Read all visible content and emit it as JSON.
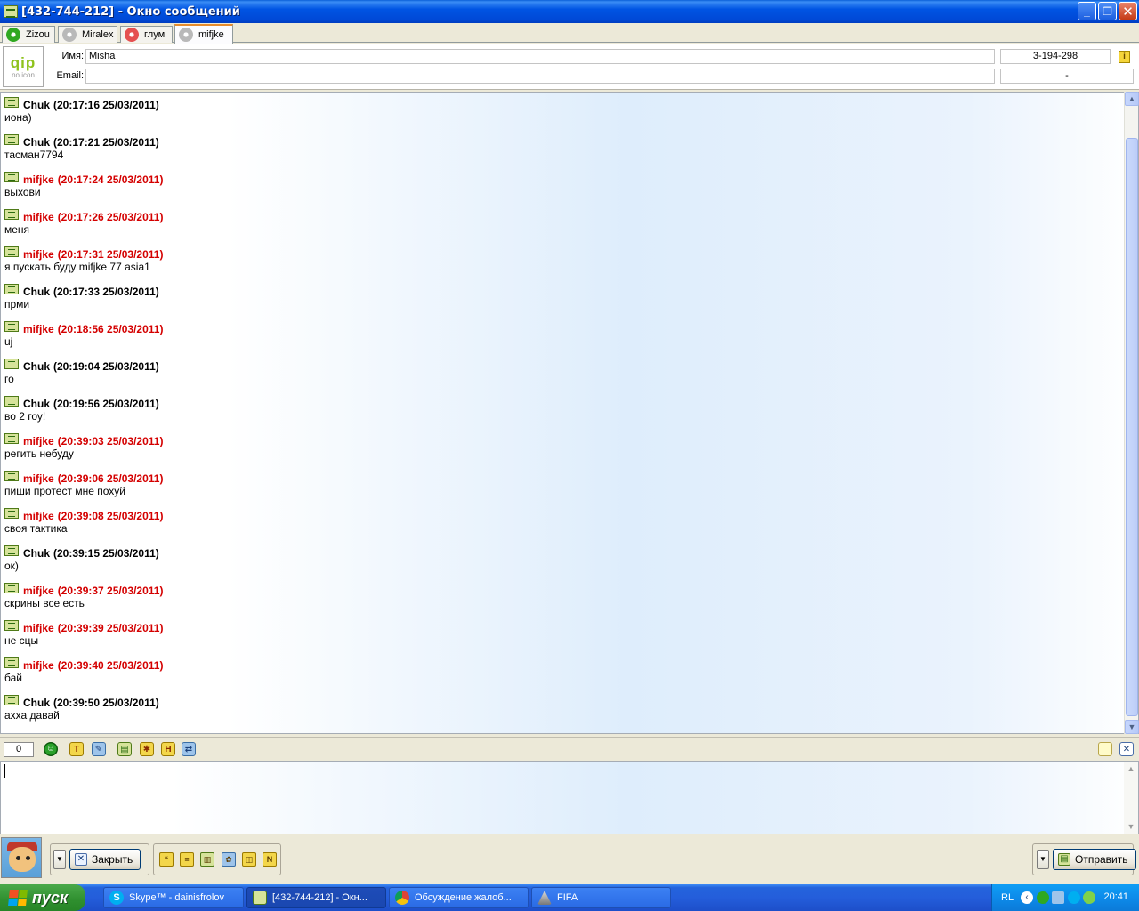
{
  "window": {
    "title": "[432-744-212] - Окно сообщений",
    "min": "_",
    "restore": "❐",
    "close": "✕"
  },
  "tabs": [
    {
      "label": "Zizou",
      "icon": "flower-green-icon",
      "active": false
    },
    {
      "label": "Miralex",
      "icon": "flower-gray-icon",
      "active": false
    },
    {
      "label": "глум",
      "icon": "flower-red-icon",
      "active": false
    },
    {
      "label": "mifjke",
      "icon": "flower-gray-icon",
      "active": true
    }
  ],
  "contact": {
    "avatar_text": "qip",
    "avatar_sub": "no icon",
    "name_label": "Имя:",
    "name_value": "Misha",
    "email_label": "Email:",
    "email_value": "",
    "uin": "3-194-298",
    "status": "-"
  },
  "colors": {
    "chuk": "#0a2a8a",
    "mifjke": "#d40000"
  },
  "messages": [
    {
      "nick": "Chuk",
      "time": "(20:17:16 25/03/2011)",
      "text": "иона)"
    },
    {
      "nick": "Chuk",
      "time": "(20:17:21 25/03/2011)",
      "text": "тасман7794"
    },
    {
      "nick": "mifjke",
      "time": "(20:17:24 25/03/2011)",
      "text": "выхови"
    },
    {
      "nick": "mifjke",
      "time": "(20:17:26 25/03/2011)",
      "text": "меня"
    },
    {
      "nick": "mifjke",
      "time": "(20:17:31 25/03/2011)",
      "text": "я пускать буду mifjke 77 asia1"
    },
    {
      "nick": "Chuk",
      "time": "(20:17:33 25/03/2011)",
      "text": "прми"
    },
    {
      "nick": "mifjke",
      "time": "(20:18:56 25/03/2011)",
      "text": "uj"
    },
    {
      "nick": "Chuk",
      "time": "(20:19:04 25/03/2011)",
      "text": "го"
    },
    {
      "nick": "Chuk",
      "time": "(20:19:56 25/03/2011)",
      "text": "во 2 гоу!"
    },
    {
      "nick": "mifjke",
      "time": "(20:39:03 25/03/2011)",
      "text": "регить небуду"
    },
    {
      "nick": "mifjke",
      "time": "(20:39:06 25/03/2011)",
      "text": "пиши протест мне похуй"
    },
    {
      "nick": "mifjke",
      "time": "(20:39:08 25/03/2011)",
      "text": "своя тактика"
    },
    {
      "nick": "Chuk",
      "time": "(20:39:15 25/03/2011)",
      "text": "ок)"
    },
    {
      "nick": "mifjke",
      "time": "(20:39:37 25/03/2011)",
      "text": "скрины все есть"
    },
    {
      "nick": "mifjke",
      "time": "(20:39:39 25/03/2011)",
      "text": "не сцы"
    },
    {
      "nick": "mifjke",
      "time": "(20:39:40 25/03/2011)",
      "text": "бай"
    },
    {
      "nick": "Chuk",
      "time": "(20:39:50 25/03/2011)",
      "text": "ахха давай"
    }
  ],
  "edit_toolbar": {
    "char_count": "0",
    "icons": [
      "smiles-icon",
      "font-icon",
      "color-icon",
      "save-icon",
      "send-file-icon",
      "history-icon",
      "translit-icon"
    ],
    "right_icons": [
      "new-message-icon",
      "clear-icon"
    ]
  },
  "input": {
    "value": ""
  },
  "bottom": {
    "close_label": "Закрыть",
    "send_label": "Отправить",
    "icons": [
      "quote-icon",
      "contact-info-icon",
      "history-book-icon",
      "services-icon",
      "paste-icon",
      "notes-icon"
    ]
  },
  "taskbar": {
    "start_label": "пуск",
    "tasks": [
      {
        "label": "Skype™ - dainisfrolov",
        "icon": "skype-icon",
        "active": false
      },
      {
        "label": "[432-744-212] - Окн...",
        "icon": "qip-icon",
        "active": true
      },
      {
        "label": "Обсуждение жалоб...",
        "icon": "chrome-icon",
        "active": false
      },
      {
        "label": "FIFA",
        "icon": "fifa-icon",
        "active": false
      }
    ],
    "tray": {
      "lang": "RL",
      "time": "20:41"
    }
  }
}
